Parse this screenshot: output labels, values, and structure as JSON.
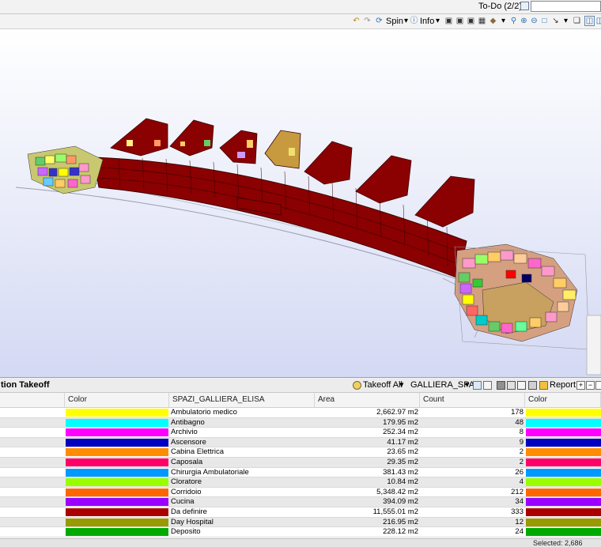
{
  "topbar": {
    "todo_label": "To-Do (2/2)"
  },
  "view_toolbar": {
    "spin_label": "Spin",
    "info_label": "Info"
  },
  "panel": {
    "title": "tion Takeoff",
    "takeoff_label": "Takeoff All",
    "filter_value": "GALLIERA_SPAZI",
    "report_label": "Report"
  },
  "table": {
    "headers": {
      "color": "Color",
      "name": "SPAZI_GALLIERA_ELISA",
      "area": "Area",
      "count": "Count",
      "color2": "Color"
    },
    "rows": [
      {
        "color": "#ffff00",
        "name": "Ambulatorio medico",
        "area": "2,662.97 m2",
        "count": "178"
      },
      {
        "color": "#00ffff",
        "name": "Antibagno",
        "area": "179.95 m2",
        "count": "48"
      },
      {
        "color": "#ff00ff",
        "name": "Archivio",
        "area": "252.34 m2",
        "count": "8"
      },
      {
        "color": "#0000c0",
        "name": "Ascensore",
        "area": "41.17 m2",
        "count": "9"
      },
      {
        "color": "#ff8c00",
        "name": "Cabina Elettrica",
        "area": "23.65 m2",
        "count": "2"
      },
      {
        "color": "#ff0066",
        "name": "Caposala",
        "area": "29.35 m2",
        "count": "2"
      },
      {
        "color": "#0099ff",
        "name": "Chirurgia Ambulatoriale",
        "area": "381.43 m2",
        "count": "26"
      },
      {
        "color": "#99ff00",
        "name": "Cloratore",
        "area": "10.84 m2",
        "count": "4"
      },
      {
        "color": "#ff6600",
        "name": "Corridoio",
        "area": "5,348.42 m2",
        "count": "212"
      },
      {
        "color": "#9900ff",
        "name": "Cucina",
        "area": "394.09 m2",
        "count": "34"
      },
      {
        "color": "#aa0000",
        "name": "Da definire",
        "area": "11,555.01 m2",
        "count": "333"
      },
      {
        "color": "#999900",
        "name": "Day Hospital",
        "area": "216.95 m2",
        "count": "12"
      },
      {
        "color": "#00aa00",
        "name": "Deposito",
        "area": "228.12 m2",
        "count": "24"
      }
    ]
  },
  "status": {
    "selected": "Selected: 2,686"
  },
  "colors": {
    "building_red": "#8b0000",
    "sky_bottom": "#d4d9f4",
    "sky_top": "#ffffff"
  }
}
